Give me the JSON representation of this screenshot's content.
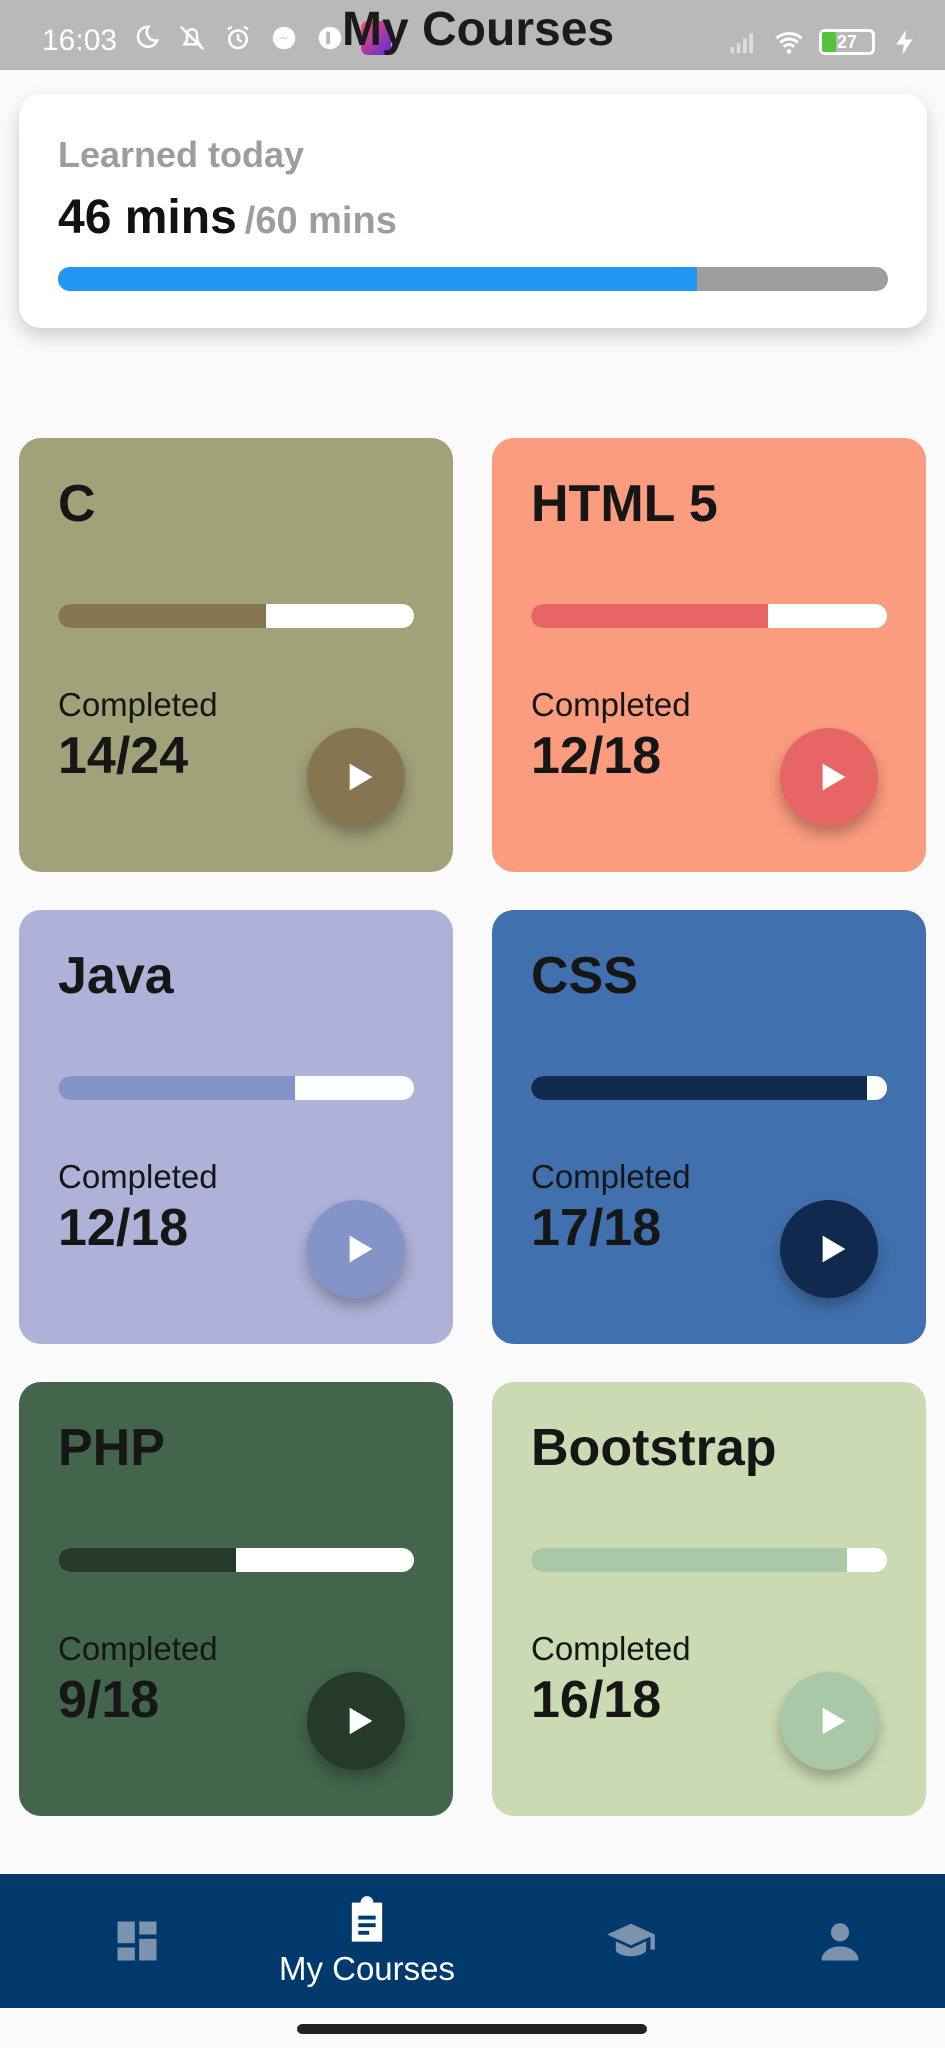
{
  "status_bar": {
    "time": "16:03",
    "title": "My Courses",
    "battery": "27",
    "battery_percent": 27,
    "icons": [
      "moon-icon",
      "mute-icon",
      "alarm-icon",
      "messenger-icon",
      "app-icon",
      "lazada-icon",
      "signal-icon",
      "wifi-icon",
      "battery-icon",
      "charging-icon"
    ]
  },
  "today": {
    "label": "Learned today",
    "value": "46 mins",
    "goal": "/60 mins",
    "progress": 0.77,
    "fill_color": "#2196f3",
    "track_color": "#9e9e9e"
  },
  "courses": [
    {
      "title": "C",
      "completed_label": "Completed",
      "count": "14/24",
      "progress": 0.583,
      "bg": "#a1a17a",
      "accent": "#857550"
    },
    {
      "title": "HTML 5",
      "completed_label": "Completed",
      "count": "12/18",
      "progress": 0.667,
      "bg": "#fa9c7d",
      "accent": "#e86565"
    },
    {
      "title": "Java",
      "completed_label": "Completed",
      "count": "12/18",
      "progress": 0.667,
      "bg": "#aeb1d8",
      "accent": "#8494c8"
    },
    {
      "title": "CSS",
      "completed_label": "Completed",
      "count": "17/18",
      "progress": 0.944,
      "bg": "#4170ae",
      "accent": "#10294d"
    },
    {
      "title": "PHP",
      "completed_label": "Completed",
      "count": "9/18",
      "progress": 0.5,
      "bg": "#42654b",
      "accent": "#253a28"
    },
    {
      "title": "Bootstrap",
      "completed_label": "Completed",
      "count": "16/18",
      "progress": 0.889,
      "bg": "#cadbb4",
      "accent": "#a8c8a8"
    }
  ],
  "bottom_nav": {
    "items": [
      {
        "icon": "dashboard-icon",
        "label": "",
        "active": false
      },
      {
        "icon": "clipboard-icon",
        "label": "My Courses",
        "active": true
      },
      {
        "icon": "graduation-cap-icon",
        "label": "",
        "active": false
      },
      {
        "icon": "person-icon",
        "label": "",
        "active": false
      }
    ],
    "bg": "#003a6c",
    "active_color": "#ffffff",
    "inactive_color": "#7b93ad"
  }
}
